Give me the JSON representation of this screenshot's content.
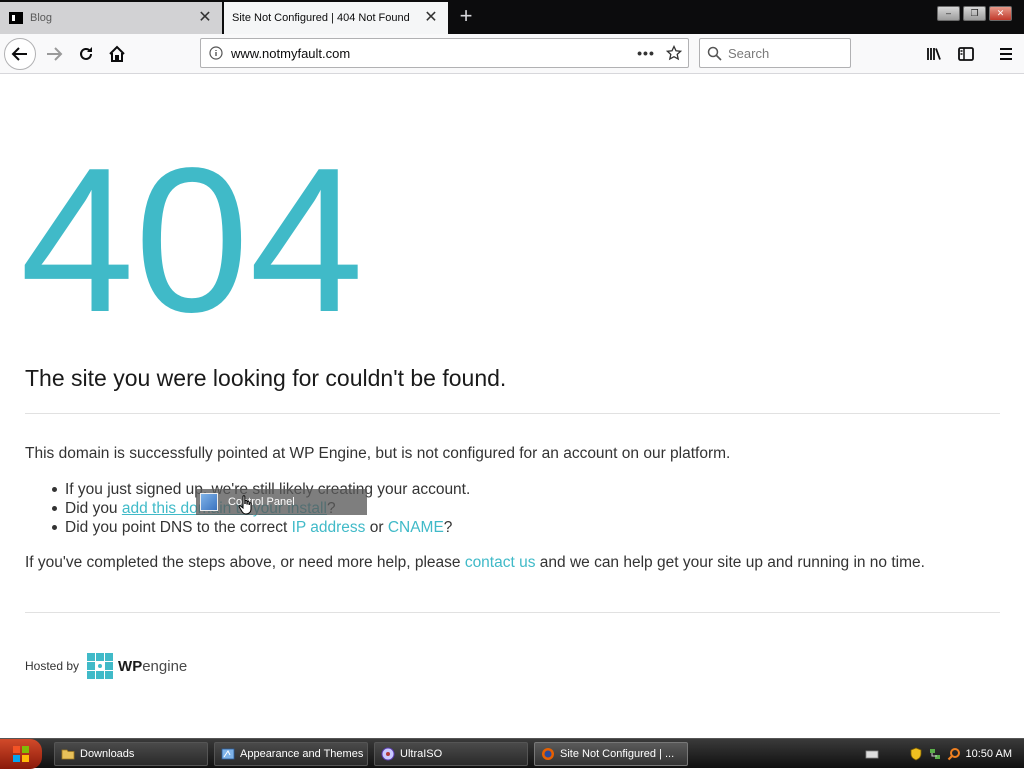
{
  "browser": {
    "tabs": [
      {
        "title": "Blog",
        "active": false
      },
      {
        "title": "Site Not Configured | 404 Not Found",
        "active": true
      }
    ],
    "url": {
      "host": "www.notmyfault.com"
    },
    "search": {
      "placeholder": "Search"
    },
    "icons": [
      "back-arrow-icon",
      "forward-arrow-icon",
      "reload-icon",
      "home-icon",
      "info-icon",
      "page-actions-icon",
      "bookmark-star-icon",
      "search-icon",
      "library-icon",
      "sidebar-icon",
      "menu-icon"
    ]
  },
  "page": {
    "code": "404",
    "headline": "The site you were looking for couldn't be found.",
    "intro": "This domain is successfully pointed at WP Engine, but is not configured for an account on our platform.",
    "bullets": {
      "b1": "If you just signed up, we're still likely creating your account.",
      "b2_pre": "Did you ",
      "b2_link": "add this domain to your install",
      "b2_post": "?",
      "b3_pre": "Did you point DNS to the correct ",
      "b3_link1": "IP address",
      "b3_mid": " or ",
      "b3_link2": "CNAME",
      "b3_post": "?"
    },
    "help": {
      "pre": "If you've completed the steps above, or need more help, please ",
      "link": "contact us",
      "post": " and we can help get your site up and running in no time."
    },
    "hosted_by": "Hosted by",
    "logo": {
      "bold": "WP",
      "rest": "engine"
    },
    "drag_tooltip": "Control Panel",
    "colors": {
      "accent": "#40bac8",
      "text": "#333333"
    }
  },
  "taskbar": {
    "tasks": [
      {
        "label": "Downloads",
        "icon": "folder-icon"
      },
      {
        "label": "Appearance and Themes",
        "icon": "control-panel-icon"
      },
      {
        "label": "UltraISO",
        "icon": "disc-icon"
      },
      {
        "label": "Site Not Configured | ...",
        "icon": "firefox-icon"
      }
    ],
    "clock": "10:50 AM"
  }
}
